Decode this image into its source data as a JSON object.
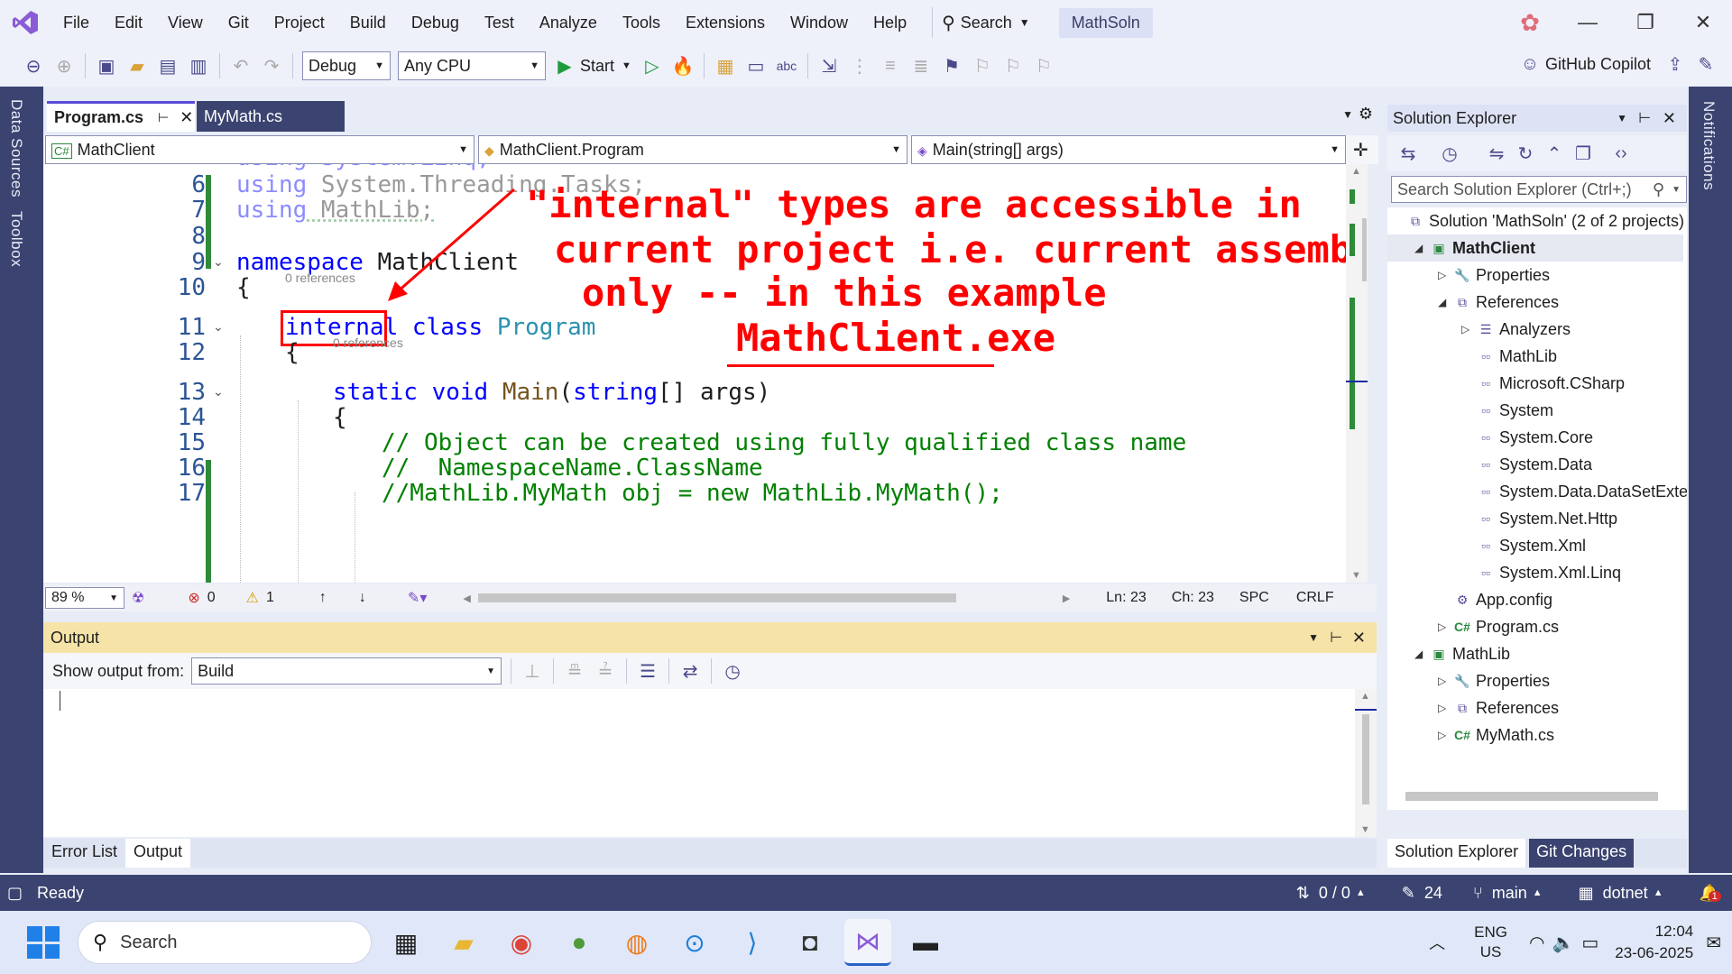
{
  "menu": [
    "File",
    "Edit",
    "View",
    "Git",
    "Project",
    "Build",
    "Debug",
    "Test",
    "Analyze",
    "Tools",
    "Extensions",
    "Window",
    "Help"
  ],
  "search_label": "Search",
  "solution_name": "MathSoln",
  "toolbar": {
    "config": "Debug",
    "platform": "Any CPU",
    "start_label": "Start",
    "copilot_label": "GitHub Copilot"
  },
  "left_tabs": [
    "Data Sources",
    "Toolbox"
  ],
  "right_tab": "Notifications",
  "doc_tabs": [
    {
      "label": "Program.cs",
      "active": true
    },
    {
      "label": "MyMath.cs",
      "active": false
    }
  ],
  "nav": {
    "project": "MathClient",
    "type": "MathClient.Program",
    "member": "Main(string[] args)"
  },
  "code": {
    "line_numbers": [
      "6",
      "7",
      "8",
      "9",
      "10",
      "11",
      "12",
      "13",
      "14",
      "15",
      "16",
      "17"
    ],
    "line5_partial": "using System.Linq;",
    "line6": [
      "using",
      " System.Threading.Tasks;"
    ],
    "line7": [
      "using",
      " MathLib;"
    ],
    "line9": [
      "namespace",
      " MathClient"
    ],
    "line10": "{",
    "refs_class": "0 references",
    "line11": [
      "internal",
      "class",
      "Program"
    ],
    "line12": "{",
    "refs_main": "0 references",
    "line13": [
      "static void ",
      "Main",
      "(",
      "string",
      "[] args)"
    ],
    "line14": "{",
    "line15": "// Object can be created using fully qualified class name",
    "line16": "//  NamespaceName.ClassName",
    "line17": "//MathLib.MyMath obj = new MathLib.MyMath();"
  },
  "annotation": {
    "line1": "\"internal\" types are accessible in",
    "line2": "current project i.e. current assembly",
    "line3": "only -- in this example",
    "line4": "MathClient.exe",
    "color": "#ff0000"
  },
  "editor_status": {
    "zoom": "89 %",
    "errors": "0",
    "warnings": "1",
    "ln": "Ln: 23",
    "ch": "Ch: 23",
    "spc": "SPC",
    "crlf": "CRLF"
  },
  "output": {
    "title": "Output",
    "show_from_label": "Show output from:",
    "source": "Build"
  },
  "bottom_tabs": [
    "Error List",
    "Output"
  ],
  "solution_explorer": {
    "title": "Solution Explorer",
    "search_placeholder": "Search Solution Explorer (Ctrl+;)",
    "tree": [
      {
        "label": "Solution 'MathSoln' (2 of 2 projects)",
        "depth": 0,
        "icon": "solution-icon",
        "bold": false
      },
      {
        "label": "MathClient",
        "depth": 1,
        "icon": "csproj-icon",
        "bold": true
      },
      {
        "label": "Properties",
        "depth": 2,
        "icon": "wrench-icon",
        "bold": false
      },
      {
        "label": "References",
        "depth": 2,
        "icon": "references-icon",
        "bold": false
      },
      {
        "label": "Analyzers",
        "depth": 3,
        "icon": "analyzer-icon",
        "bold": false
      },
      {
        "label": "MathLib",
        "depth": 3,
        "icon": "reference-icon",
        "bold": false
      },
      {
        "label": "Microsoft.CSharp",
        "depth": 3,
        "icon": "reference-icon",
        "bold": false
      },
      {
        "label": "System",
        "depth": 3,
        "icon": "reference-icon",
        "bold": false
      },
      {
        "label": "System.Core",
        "depth": 3,
        "icon": "reference-icon",
        "bold": false
      },
      {
        "label": "System.Data",
        "depth": 3,
        "icon": "reference-icon",
        "bold": false
      },
      {
        "label": "System.Data.DataSetExtensions",
        "depth": 3,
        "icon": "reference-icon",
        "bold": false
      },
      {
        "label": "System.Net.Http",
        "depth": 3,
        "icon": "reference-icon",
        "bold": false
      },
      {
        "label": "System.Xml",
        "depth": 3,
        "icon": "reference-icon",
        "bold": false
      },
      {
        "label": "System.Xml.Linq",
        "depth": 3,
        "icon": "reference-icon",
        "bold": false
      },
      {
        "label": "App.config",
        "depth": 2,
        "icon": "config-icon",
        "bold": false
      },
      {
        "label": "Program.cs",
        "depth": 2,
        "icon": "csharp-file-icon",
        "bold": false
      },
      {
        "label": "MathLib",
        "depth": 1,
        "icon": "csproj-icon",
        "bold": false
      },
      {
        "label": "Properties",
        "depth": 2,
        "icon": "wrench-icon",
        "bold": false
      },
      {
        "label": "References",
        "depth": 2,
        "icon": "references-icon",
        "bold": false
      },
      {
        "label": "MyMath.cs",
        "depth": 2,
        "icon": "csharp-file-icon",
        "bold": false
      }
    ],
    "tabs": [
      "Solution Explorer",
      "Git Changes"
    ]
  },
  "statusbar": {
    "ready": "Ready",
    "updown": "0 / 0",
    "pencil_count": "24",
    "branch": "main",
    "repo": "dotnet",
    "notif_count": "1"
  },
  "taskbar": {
    "search": "Search",
    "lang1": "ENG",
    "lang2": "US",
    "time": "12:04",
    "date": "23-06-2025"
  }
}
